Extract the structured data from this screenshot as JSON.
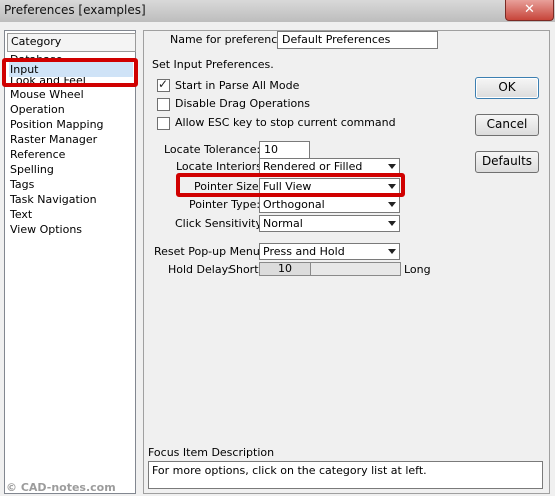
{
  "window": {
    "title": "Preferences [examples]",
    "close_glyph": "✕"
  },
  "category": {
    "header": "Category",
    "items": [
      {
        "label": "Database"
      },
      {
        "label": "Input",
        "selected": true
      },
      {
        "label": "Look and Feel"
      },
      {
        "label": "Mouse Wheel"
      },
      {
        "label": "Operation"
      },
      {
        "label": "Position Mapping"
      },
      {
        "label": "Raster Manager"
      },
      {
        "label": "Reference"
      },
      {
        "label": "Spelling"
      },
      {
        "label": "Tags"
      },
      {
        "label": "Task Navigation"
      },
      {
        "label": "Text"
      },
      {
        "label": "View Options"
      }
    ]
  },
  "name_for_preferences": {
    "label": "Name for preferences",
    "value": "Default Preferences"
  },
  "input": {
    "section_title": "Set Input Preferences.",
    "checkboxes": [
      {
        "label": "Start in Parse All Mode",
        "checked": true
      },
      {
        "label": "Disable Drag Operations",
        "checked": false
      },
      {
        "label": "Allow ESC key to stop current command",
        "checked": false
      }
    ],
    "locate_tolerance": {
      "label": "Locate Tolerance:",
      "value": "10"
    },
    "locate_interiors": {
      "label": "Locate Interiors:",
      "value": "Rendered or Filled"
    },
    "pointer_size": {
      "label": "Pointer Size:",
      "value": "Full View"
    },
    "pointer_type": {
      "label": "Pointer Type:",
      "value": "Orthogonal"
    },
    "click_sensitivity": {
      "label": "Click Sensitivity:",
      "value": "Normal"
    },
    "reset_popup": {
      "label": "Reset Pop-up Menu:",
      "value": "Press and Hold"
    },
    "hold_delay": {
      "label": "Hold Delay:",
      "short": "Short",
      "long": "Long",
      "value": "10"
    }
  },
  "buttons": {
    "ok": "OK",
    "cancel": "Cancel",
    "defaults": "Defaults"
  },
  "focus_description": {
    "title": "Focus Item Description",
    "text": "For more options, click on the category list at left."
  },
  "watermark": "© CAD-notes.com",
  "annotation_color": "#d00000",
  "selection_color": "#cfe3f7"
}
